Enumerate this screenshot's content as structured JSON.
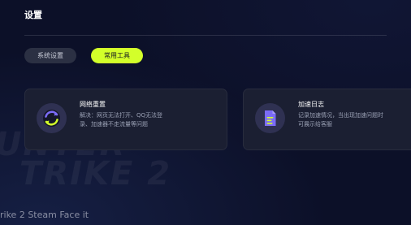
{
  "page": {
    "title": "设置"
  },
  "tabs": [
    {
      "label": "系统设置",
      "active": false
    },
    {
      "label": "常用工具",
      "active": true
    }
  ],
  "tools": [
    {
      "title": "网络重置",
      "desc_line1": "解决：网页无法打开、QQ无法登",
      "desc_line2": "录、加速器不走流量等问题",
      "icon": "refresh-circle-icon"
    },
    {
      "title": "加速日志",
      "desc_line1": "记录加速情况，当出现加速问题时",
      "desc_line2": "可展示给客服",
      "icon": "document-icon"
    }
  ],
  "background": {
    "watermark_line1": "UNTER",
    "watermark_line2": "TRIKE 2",
    "bottom_text": "rike 2 Steam Face it"
  },
  "colors": {
    "background": "#0c1028",
    "card": "#1b1f32",
    "accent": "#d3ff2a",
    "icon_bg": "#2f3152",
    "icon_purple": "#7b6cf6"
  }
}
